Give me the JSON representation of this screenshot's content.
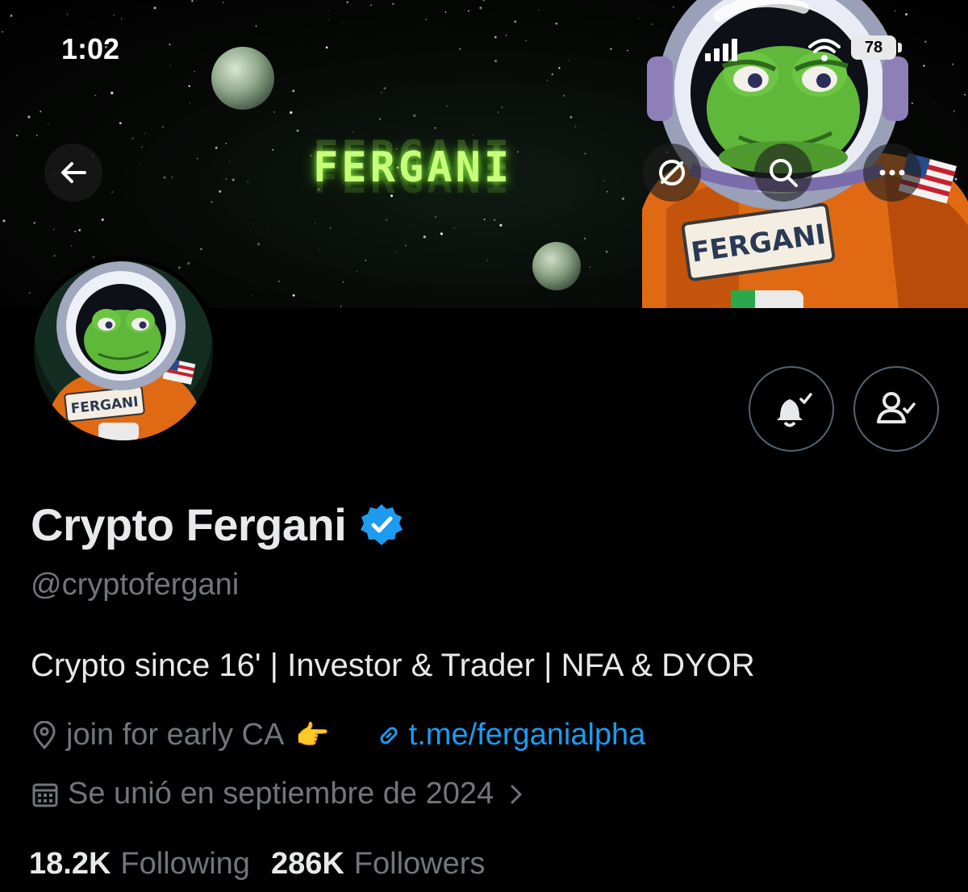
{
  "status_bar": {
    "time": "1:02",
    "battery": "78"
  },
  "banner": {
    "title": "FERGANI",
    "badge_text": "FERGANI"
  },
  "header_actions": {
    "back": "arrow-left-icon",
    "grok": "grok-icon",
    "search": "search-icon",
    "more": "more-horizontal-icon"
  },
  "avatar": {
    "badge_text": "FERGANI"
  },
  "profile_actions": {
    "notifications": "bell-check-icon",
    "following": "person-check-icon"
  },
  "profile": {
    "display_name": "Crypto Fergani",
    "handle": "@cryptofergani",
    "bio": "Crypto since 16' | Investor & Trader | NFA & DYOR",
    "location": "join for early CA",
    "location_emoji": "👉",
    "website": "t.me/ferganialpha",
    "joined": "Se unió en septiembre de 2024"
  },
  "stats": {
    "following_count": "18.2K",
    "following_label": "Following",
    "followers_count": "286K",
    "followers_label": "Followers"
  },
  "colors": {
    "accent": "#1d9bf0",
    "muted": "#71767b",
    "banner_glow": "#c8ff7a"
  }
}
